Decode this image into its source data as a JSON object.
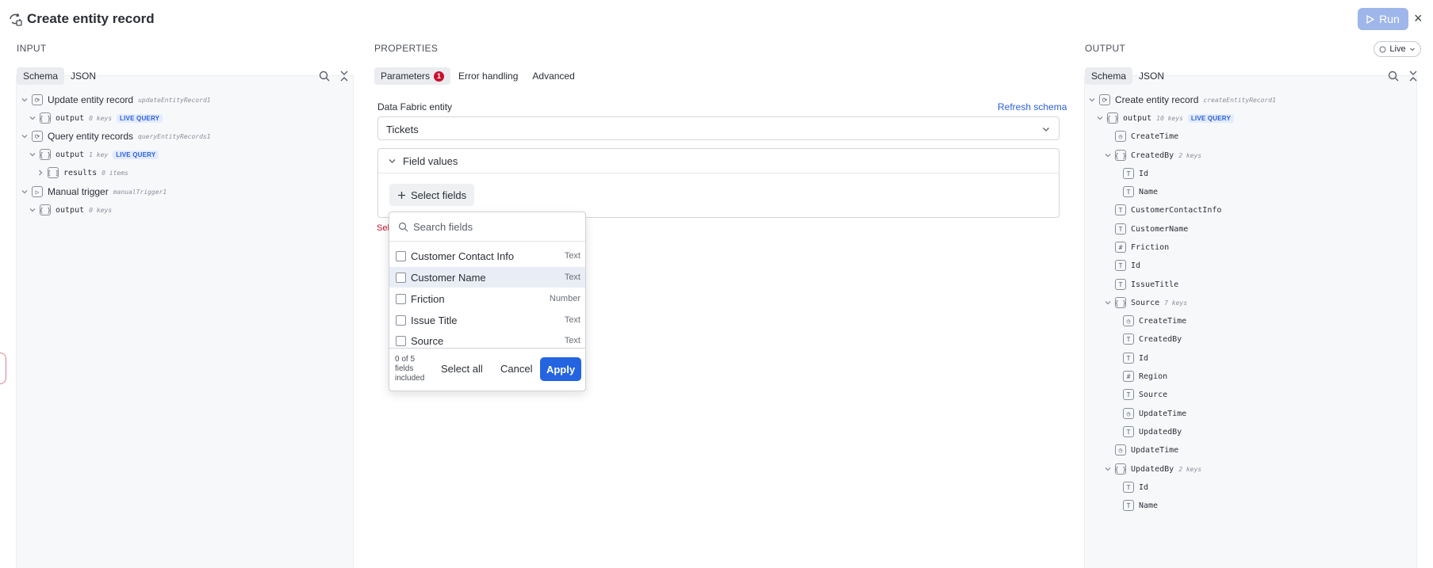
{
  "header": {
    "title": "Create entity record",
    "run_label": "Run",
    "close_glyph": "×"
  },
  "input": {
    "section_title": "INPUT",
    "tabs": [
      "Schema",
      "JSON"
    ],
    "tree": [
      {
        "label": "Update entity record",
        "sub": "updateEntityRecord1",
        "icon": "⟳"
      },
      {
        "label": "output",
        "sub": "0 keys",
        "badge": "LIVE QUERY",
        "icon": "{ }"
      },
      {
        "label": "Query entity records",
        "sub": "queryEntityRecords1",
        "icon": "⟳"
      },
      {
        "label": "output",
        "sub": "1 key",
        "badge": "LIVE QUERY",
        "icon": "{ }"
      },
      {
        "label": "results",
        "sub": "0 items",
        "icon": "[ ]"
      },
      {
        "label": "Manual trigger",
        "sub": "manualTrigger1",
        "icon": "▷"
      },
      {
        "label": "output",
        "sub": "0 keys",
        "icon": "{ }"
      }
    ]
  },
  "properties": {
    "section_title": "PROPERTIES",
    "tabs": [
      {
        "label": "Parameters",
        "badge": "1"
      },
      {
        "label": "Error handling"
      },
      {
        "label": "Advanced"
      }
    ],
    "entity_label": "Data Fabric entity",
    "refresh_label": "Refresh schema",
    "entity_value": "Tickets",
    "field_values_label": "Field values",
    "select_fields_label": "Select fields",
    "error_text": "Sel"
  },
  "dropdown": {
    "search_placeholder": "Search fields",
    "items": [
      {
        "name": "Customer Contact Info",
        "type": "Text"
      },
      {
        "name": "Customer Name",
        "type": "Text"
      },
      {
        "name": "Friction",
        "type": "Number"
      },
      {
        "name": "Issue Title",
        "type": "Text"
      },
      {
        "name": "Source",
        "type": "Text"
      }
    ],
    "count_text": "0 of 5 fields included",
    "select_all_label": "Select all",
    "cancel_label": "Cancel",
    "apply_label": "Apply"
  },
  "output": {
    "section_title": "OUTPUT",
    "live_label": "Live",
    "tabs": [
      "Schema",
      "JSON"
    ],
    "tree": [
      {
        "label": "Create entity record",
        "sub": "createEntityRecord1",
        "icon": "⟳"
      },
      {
        "label": "output",
        "sub": "10 keys",
        "badge": "LIVE QUERY",
        "icon": "{ }"
      },
      {
        "label": "CreateTime",
        "icon": "◷"
      },
      {
        "label": "CreatedBy",
        "sub": "2 keys",
        "icon": "{ }"
      },
      {
        "label": "Id",
        "icon": "T"
      },
      {
        "label": "Name",
        "icon": "T"
      },
      {
        "label": "CustomerContactInfo",
        "icon": "T"
      },
      {
        "label": "CustomerName",
        "icon": "T"
      },
      {
        "label": "Friction",
        "icon": "#"
      },
      {
        "label": "Id",
        "icon": "T"
      },
      {
        "label": "IssueTitle",
        "icon": "T"
      },
      {
        "label": "Source",
        "sub": "7 keys",
        "icon": "{ }"
      },
      {
        "label": "CreateTime",
        "icon": "◷"
      },
      {
        "label": "CreatedBy",
        "icon": "T"
      },
      {
        "label": "Id",
        "icon": "T"
      },
      {
        "label": "Region",
        "icon": "#"
      },
      {
        "label": "Source",
        "icon": "T"
      },
      {
        "label": "UpdateTime",
        "icon": "◷"
      },
      {
        "label": "UpdatedBy",
        "icon": "T"
      },
      {
        "label": "UpdateTime",
        "icon": "◷"
      },
      {
        "label": "UpdatedBy",
        "sub": "2 keys",
        "icon": "{ }"
      },
      {
        "label": "Id",
        "icon": "T"
      },
      {
        "label": "Name",
        "icon": "T"
      }
    ]
  }
}
